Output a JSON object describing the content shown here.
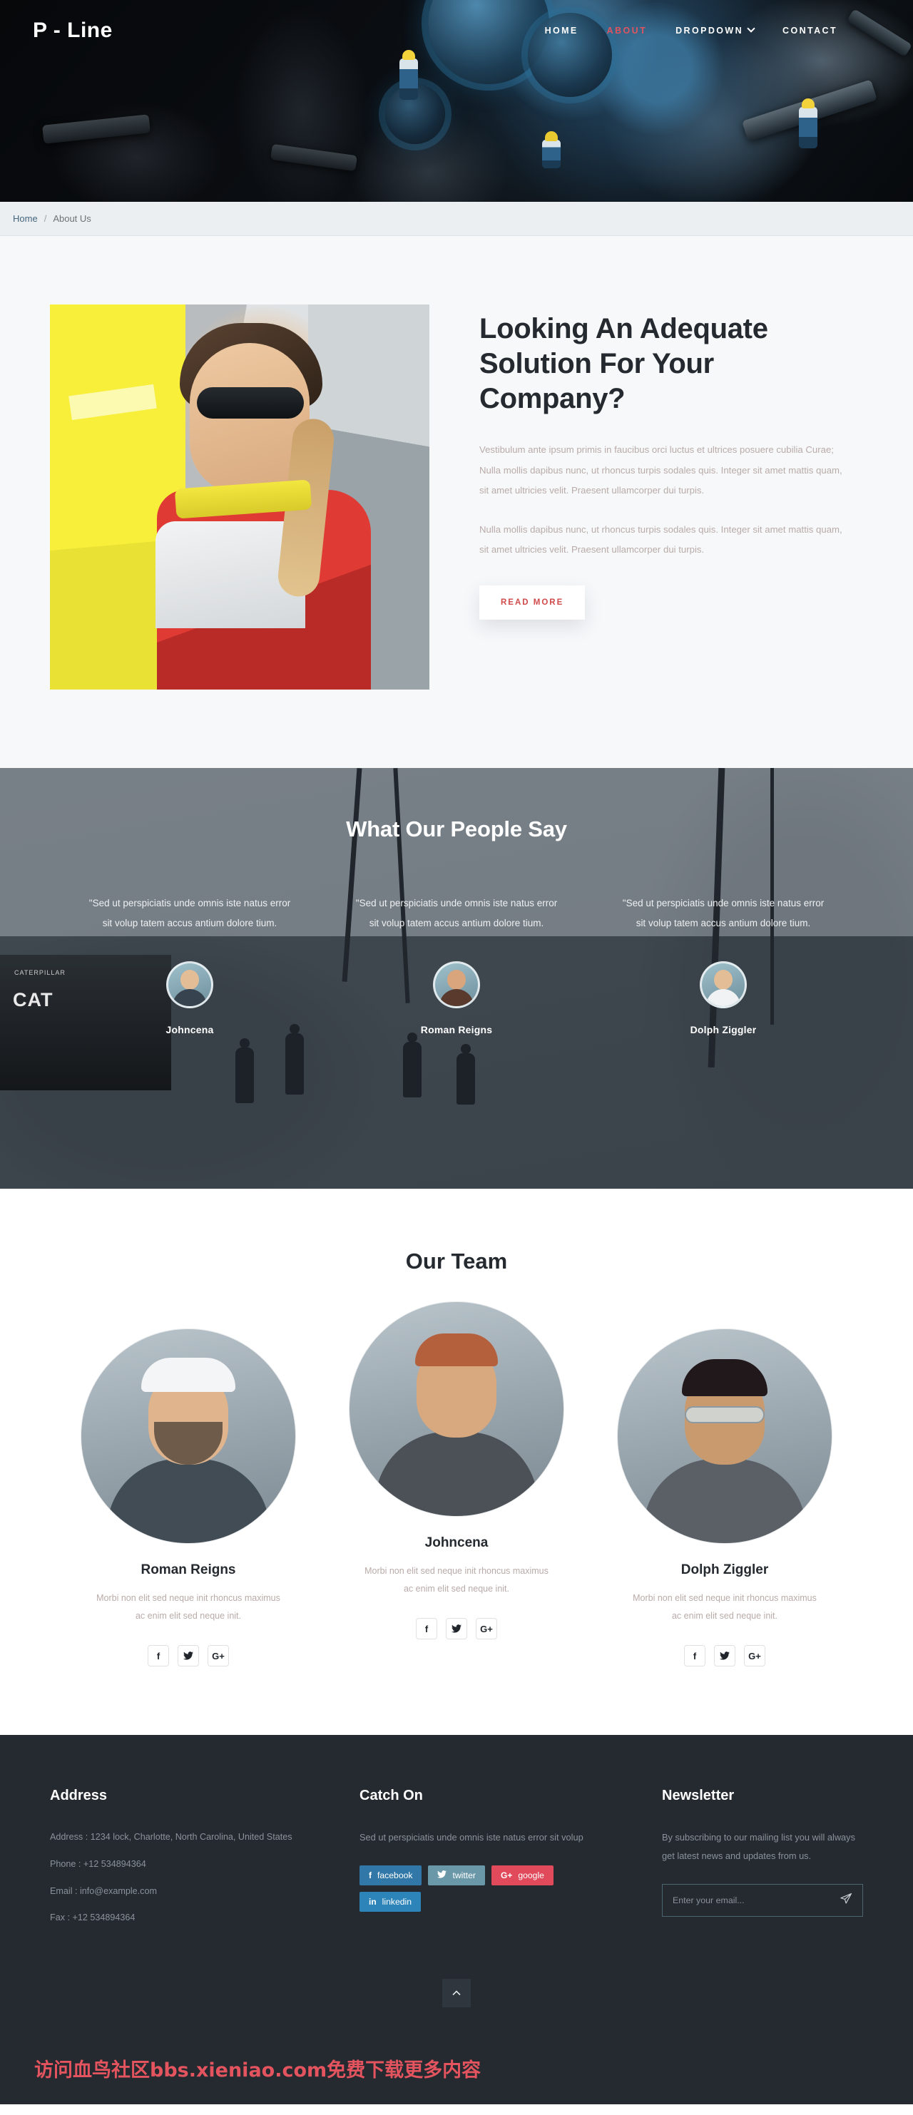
{
  "header": {
    "brand": "P - Line",
    "nav": [
      {
        "label": "HOME",
        "active": false,
        "dropdown": false
      },
      {
        "label": "ABOUT",
        "active": true,
        "dropdown": false
      },
      {
        "label": "DROPDOWN",
        "active": false,
        "dropdown": true
      },
      {
        "label": "CONTACT",
        "active": false,
        "dropdown": false
      }
    ]
  },
  "breadcrumb": {
    "home": "Home",
    "separator": "/",
    "current": "About Us"
  },
  "about": {
    "heading": "Looking An Adequate Solution For Your Company?",
    "paragraph1": "Vestibulum ante ipsum primis in faucibus orci luctus et ultrices posuere cubilia Curae; Nulla mollis dapibus nunc, ut rhoncus turpis sodales quis. Integer sit amet mattis quam, sit amet ultricies velit. Praesent ullamcorper dui turpis.",
    "paragraph2": "Nulla mollis dapibus nunc, ut rhoncus turpis sodales quis. Integer sit amet mattis quam, sit amet ultricies velit. Praesent ullamcorper dui turpis.",
    "button": "READ MORE"
  },
  "testimonials": {
    "title": "What Our People Say",
    "items": [
      {
        "quote": "\"Sed ut perspiciatis unde omnis iste natus error sit volup tatem accus antium dolore tium.",
        "name": "Johncena"
      },
      {
        "quote": "\"Sed ut perspiciatis unde omnis iste natus error sit volup tatem accus antium dolore tium.",
        "name": "Roman Reigns"
      },
      {
        "quote": "\"Sed ut perspiciatis unde omnis iste natus error sit volup tatem accus antium dolore tium.",
        "name": "Dolph Ziggler"
      }
    ]
  },
  "team": {
    "title": "Our Team",
    "members": [
      {
        "name": "Roman Reigns",
        "desc": "Morbi non elit sed neque init rhoncus maximus ac enim elit sed neque init.",
        "socials": [
          "f",
          "twitter-bird",
          "G+"
        ]
      },
      {
        "name": "Johncena",
        "desc": "Morbi non elit sed neque init rhoncus maximus ac enim elit sed neque init.",
        "socials": [
          "f",
          "twitter-bird",
          "G+"
        ]
      },
      {
        "name": "Dolph Ziggler",
        "desc": "Morbi non elit sed neque init rhoncus maximus ac enim elit sed neque init.",
        "socials": [
          "f",
          "twitter-bird",
          "G+"
        ]
      }
    ]
  },
  "footer": {
    "address": {
      "title": "Address",
      "line1": "Address : 1234 lock, Charlotte, North Carolina, United States",
      "line2": "Phone : +12 534894364",
      "line3": "Email : info@example.com",
      "line4": "Fax : +12 534894364"
    },
    "catch_on": {
      "title": "Catch On",
      "text": "Sed ut perspiciatis unde omnis iste natus error sit volup",
      "buttons": [
        {
          "label": "facebook",
          "color": "#3178a8"
        },
        {
          "label": "twitter",
          "color": "#6a98a8"
        },
        {
          "label": "google",
          "color": "#e04a5a"
        },
        {
          "label": "linkedin",
          "color": "#2c84b8"
        }
      ]
    },
    "newsletter": {
      "title": "Newsletter",
      "text": "By subscribing to our mailing list you will always get latest news and updates from us.",
      "placeholder": "Enter your email...",
      "send_icon": "send-icon"
    },
    "to_top": "scroll-to-top",
    "watermark": "访问血鸟社区bbs.xieniao.com免费下载更多内容"
  },
  "colors": {
    "accent_red": "#e0545f",
    "dark": "#242a30",
    "muted": "#b9aba8"
  }
}
